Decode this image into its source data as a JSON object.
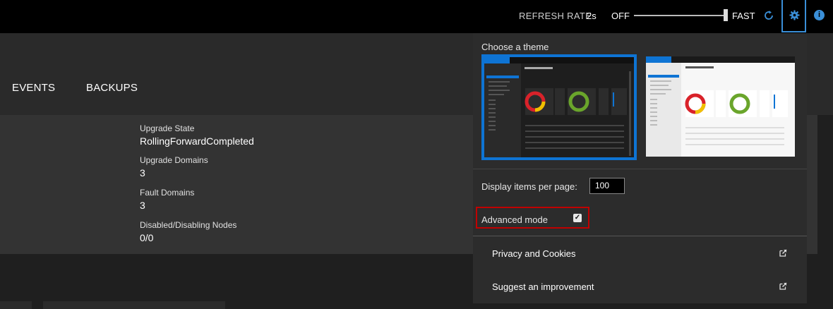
{
  "topbar": {
    "refresh_rate_label": "REFRESH RATE",
    "refresh_rate_value": "2s",
    "slider_min_label": "OFF",
    "slider_max_label": "FAST",
    "slider_level": 1.0,
    "info_glyph": "i",
    "icons": [
      "refresh-icon",
      "gear-icon",
      "info-icon"
    ]
  },
  "tabs": [
    {
      "label": "EVENTS"
    },
    {
      "label": "BACKUPS"
    }
  ],
  "details": [
    {
      "label": "Upgrade State",
      "value": "RollingForwardCompleted"
    },
    {
      "label": "Upgrade Domains",
      "value": "3"
    },
    {
      "label": "Fault Domains",
      "value": "3"
    },
    {
      "label": "Disabled/Disabling Nodes",
      "value": "0/0"
    }
  ],
  "settings": {
    "choose_theme_label": "Choose a theme",
    "themes": [
      {
        "name": "dark",
        "selected": true
      },
      {
        "name": "light",
        "selected": false
      }
    ],
    "items_per_page_label": "Display items per page:",
    "items_per_page_value": "100",
    "advanced_mode_label": "Advanced mode",
    "advanced_mode_checked": true,
    "links": [
      {
        "label": "Privacy and Cookies",
        "icon": "external-link-icon"
      },
      {
        "label": "Suggest an improvement",
        "icon": "external-link-icon"
      }
    ]
  },
  "colors": {
    "accent": "#0e74d4",
    "highlight": "#c00000",
    "background": "#1f1f1f",
    "topbar": "#000000"
  }
}
